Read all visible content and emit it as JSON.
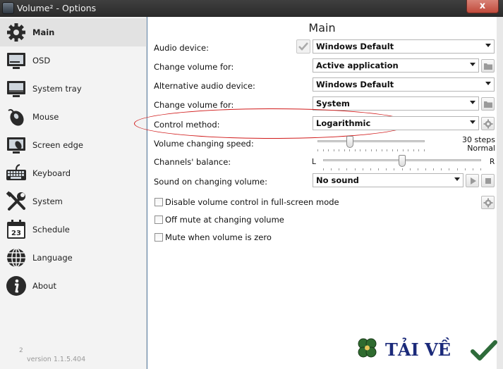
{
  "window": {
    "title": "Volume² - Options",
    "close_glyph": "x"
  },
  "sidebar": {
    "items": [
      {
        "label": "Main",
        "icon": "gear-icon",
        "active": true
      },
      {
        "label": "OSD",
        "icon": "monitor-icon",
        "active": false
      },
      {
        "label": "System tray",
        "icon": "system-tray-icon",
        "active": false
      },
      {
        "label": "Mouse",
        "icon": "mouse-icon",
        "active": false
      },
      {
        "label": "Screen edge",
        "icon": "screen-edge-icon",
        "active": false
      },
      {
        "label": "Keyboard",
        "icon": "keyboard-icon",
        "active": false
      },
      {
        "label": "System",
        "icon": "tools-icon",
        "active": false
      },
      {
        "label": "Schedule",
        "icon": "calendar-icon",
        "active": false
      },
      {
        "label": "Language",
        "icon": "globe-icon",
        "active": false
      },
      {
        "label": "About",
        "icon": "info-icon",
        "active": false
      }
    ],
    "calendar_day": "23",
    "version_sup": "2",
    "version": "version 1.1.5.404"
  },
  "main": {
    "title": "Main",
    "audio_device_label": "Audio device:",
    "audio_device_value": "Windows Default",
    "change_volume_label_1": "Change volume for:",
    "change_volume_value_1": "Active application",
    "alt_audio_device_label": "Alternative audio device:",
    "alt_audio_device_value": "Windows Default",
    "change_volume_label_2": "Change volume for:",
    "change_volume_value_2": "System",
    "control_method_label": "Control method:",
    "control_method_value": "Logarithmic",
    "speed_label": "Volume changing speed:",
    "speed_steps": "30 steps",
    "speed_mode": "Normal",
    "speed_fraction": 0.3,
    "balance_label": "Channels' balance:",
    "balance_left": "L",
    "balance_right": "R",
    "balance_fraction": 0.5,
    "sound_label": "Sound on changing volume:",
    "sound_value": "No sound",
    "cb_fullscreen": "Disable volume control in full-screen mode",
    "cb_offmute": "Off mute at changing volume",
    "cb_mutezero": "Mute when volume is zero"
  },
  "footer": {
    "watermark_text": "TẢI VỀ"
  },
  "colors": {
    "highlight_ellipse": "#d01818",
    "ok_check": "#2e6b3a",
    "watermark_text": "#1b2a7a"
  }
}
